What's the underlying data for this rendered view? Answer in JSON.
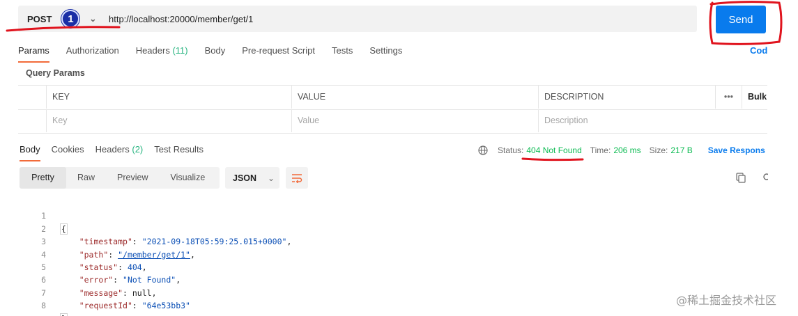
{
  "request": {
    "method": "POST",
    "step_badge": "1",
    "url": "http://localhost:20000/member/get/1",
    "send_label": "Send"
  },
  "request_tabs": [
    {
      "label": "Params",
      "active": true
    },
    {
      "label": "Authorization"
    },
    {
      "label": "Headers ",
      "count": "(11)"
    },
    {
      "label": "Body"
    },
    {
      "label": "Pre-request Script"
    },
    {
      "label": "Tests"
    },
    {
      "label": "Settings"
    }
  ],
  "code_link": "Cod",
  "query_params": {
    "title": "Query Params",
    "headers": {
      "key": "KEY",
      "value": "VALUE",
      "description": "DESCRIPTION",
      "more": "•••",
      "bulk": "Bulk"
    },
    "placeholders": {
      "key": "Key",
      "value": "Value",
      "description": "Description"
    }
  },
  "response_tabs": [
    {
      "label": "Body",
      "active": true
    },
    {
      "label": "Cookies"
    },
    {
      "label": "Headers ",
      "count": "(2)"
    },
    {
      "label": "Test Results"
    }
  ],
  "response_meta": {
    "status_label": "Status:",
    "status_value": "404 Not Found",
    "time_label": "Time:",
    "time_value": "206 ms",
    "size_label": "Size:",
    "size_value": "217 B",
    "save_label": "Save Respons"
  },
  "view_options": [
    "Pretty",
    "Raw",
    "Preview",
    "Visualize"
  ],
  "format": "JSON",
  "response_json": {
    "line_numbers": [
      "1",
      "2",
      "3",
      "4",
      "5",
      "6",
      "7",
      "8"
    ],
    "open_brace": "{",
    "close_brace": "}",
    "fields": [
      {
        "key": "\"timestamp\"",
        "value": "\"2021-09-18T05:59:25.015+0000\"",
        "kind": "str"
      },
      {
        "key": "\"path\"",
        "value": "\"/member/get/1\"",
        "kind": "link"
      },
      {
        "key": "\"status\"",
        "value": "404",
        "kind": "num"
      },
      {
        "key": "\"error\"",
        "value": "\"Not Found\"",
        "kind": "str"
      },
      {
        "key": "\"message\"",
        "value": "null",
        "kind": "plain"
      },
      {
        "key": "\"requestId\"",
        "value": "\"64e53bb3\"",
        "kind": "str",
        "last": true
      }
    ]
  },
  "watermark": "@稀土掘金技术社区",
  "colors": {
    "accent": "#f26b3a",
    "send": "#097bed",
    "status_ok": "#0cbb52",
    "annotation": "#e0141e"
  }
}
